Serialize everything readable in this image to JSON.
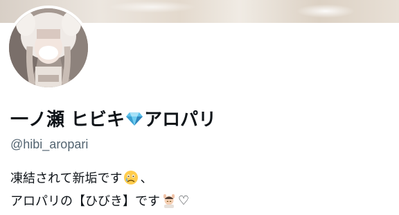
{
  "profile": {
    "name_part1": "一ノ瀬 ヒビキ",
    "name_icon": "gem-stone-icon",
    "name_part2": "アロパリ",
    "handle": "@hibi_aropari",
    "bio_line1_text": "凍結されて新垢です",
    "bio_line1_icon": "face-holding-back-tears-icon",
    "bio_line1_suffix": "、",
    "bio_line2_text": "アロパリの【ひびき】です",
    "bio_line2_icon": "person-getting-massage-icon",
    "bio_line2_suffix": "♡"
  },
  "colors": {
    "text": "#0f1419",
    "secondary_text": "#536471",
    "gem": "#5bc0eb"
  }
}
